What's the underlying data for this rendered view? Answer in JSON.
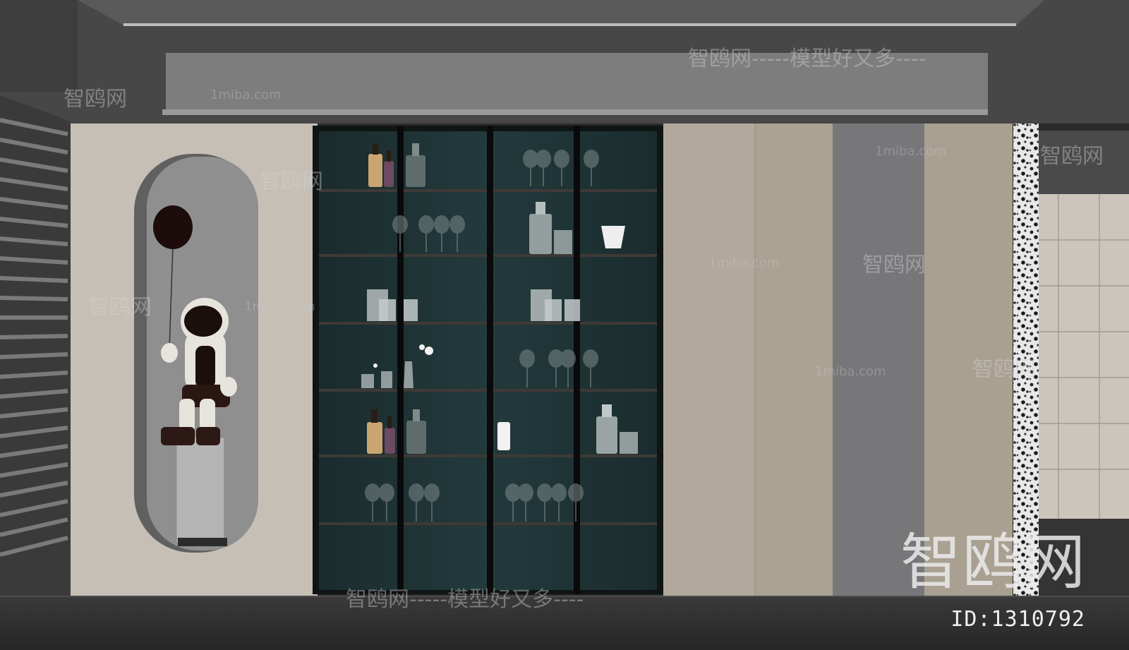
{
  "watermarks": {
    "site_cn": "智鸥网",
    "slogan": "智鸥网-----模型好又多----",
    "slogan_bottom": "智鸥网-----模型好又多----",
    "domain": "1miba.com",
    "dash_line": "-----智鸥网------",
    "id_text": "ID:1310792"
  },
  "colors": {
    "ceiling": "#4a4a4a",
    "soffit": "#7d7d7d",
    "wall": "#c6bfb6",
    "cabinet_glass": "#1e3234",
    "cabinet_frame": "#111111",
    "floor": "#2f2f2f",
    "panel_grey": "#77777a",
    "panel_beige": "#aca294",
    "balloon": "#1c0c0c"
  },
  "shelf_levels": 7
}
